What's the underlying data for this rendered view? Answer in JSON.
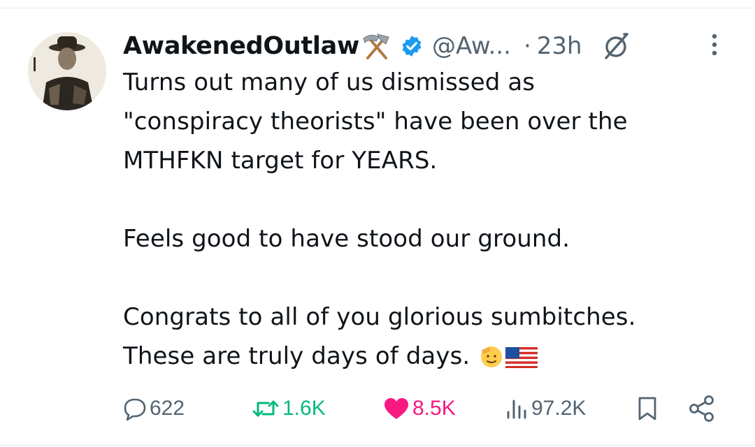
{
  "tweet": {
    "author": {
      "display_name": "AwakenedOutlaw",
      "name_emoji": "hammer-and-pick-emoji",
      "verified": true,
      "handle": "@Aw...",
      "separator": "·",
      "time_ago": "23h"
    },
    "body_lines": [
      "Turns out many of us dismissed as",
      "\"conspiracy theorists\" have been over the",
      "MTHFKN target for YEARS.",
      "",
      "Feels good to have stood our ground.",
      "",
      "Congrats to all of you glorious sumbitches.",
      "These are truly days of days."
    ],
    "trailing_emojis": [
      "saluting-face-emoji",
      "us-flag-emoji"
    ],
    "actions": {
      "replies": "622",
      "retweets": "1.6K",
      "likes": "8.5K",
      "views": "97.2K"
    }
  },
  "icons": {
    "verified": "verified-badge-icon",
    "grok": "grok-icon",
    "more": "more-options-icon",
    "reply": "reply-icon",
    "retweet": "retweet-icon",
    "like": "heart-icon",
    "views": "views-icon",
    "bookmark": "bookmark-icon",
    "share": "share-icon"
  },
  "colors": {
    "text": "#0f1419",
    "secondary": "#536471",
    "verified": "#1d9bf0",
    "retweet": "#00ba7c",
    "like": "#f91880",
    "divider": "#e7e9ea"
  }
}
